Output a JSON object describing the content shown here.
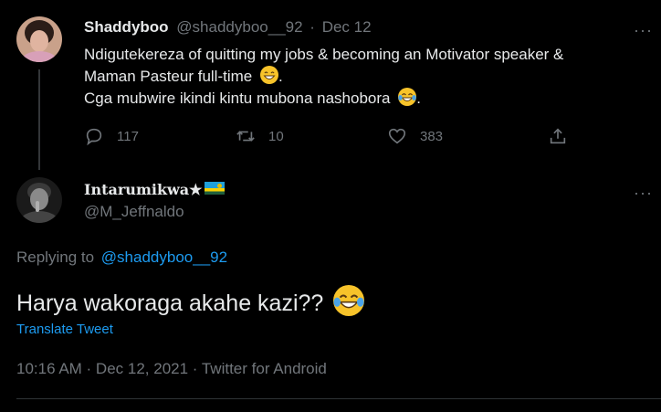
{
  "parent_tweet": {
    "display_name": "Shaddyboo",
    "handle": "@shaddyboo__92",
    "separator": "·",
    "date": "Dec 12",
    "more_label": "···",
    "text_line1": "Ndigutekereza of quitting my jobs & becoming an Motivator  speaker &",
    "text_line2": "Maman Pasteur  full-time",
    "text_line2_end": ".",
    "text_line3": "Cga mubwire ikindi kintu mubona nashobora",
    "text_line3_end": ".",
    "reply_count": "117",
    "retweet_count": "10",
    "like_count": "383"
  },
  "main_tweet": {
    "display_name": "Intarumikwa★",
    "handle": "@M_Jeffnaldo",
    "more_label": "···",
    "replying_prefix": "Replying to",
    "replying_handle": "@shaddyboo__92",
    "text": "Harya wakoraga akahe kazi??",
    "translate_label": "Translate Tweet",
    "meta": "10:16 AM · Dec 12, 2021 · Twitter for Android"
  },
  "colors": {
    "background": "#000000",
    "text": "#e7e9ea",
    "muted": "#71767b",
    "link": "#1d9bf0",
    "divider": "#2f3336"
  },
  "icons": {
    "reply": "reply-icon",
    "retweet": "retweet-icon",
    "like": "heart-icon",
    "share": "share-icon",
    "grin_emoji": "grinning-face-emoji",
    "tears_emoji": "face-with-tears-of-joy-emoji",
    "flag": "rwanda-flag-emoji"
  }
}
